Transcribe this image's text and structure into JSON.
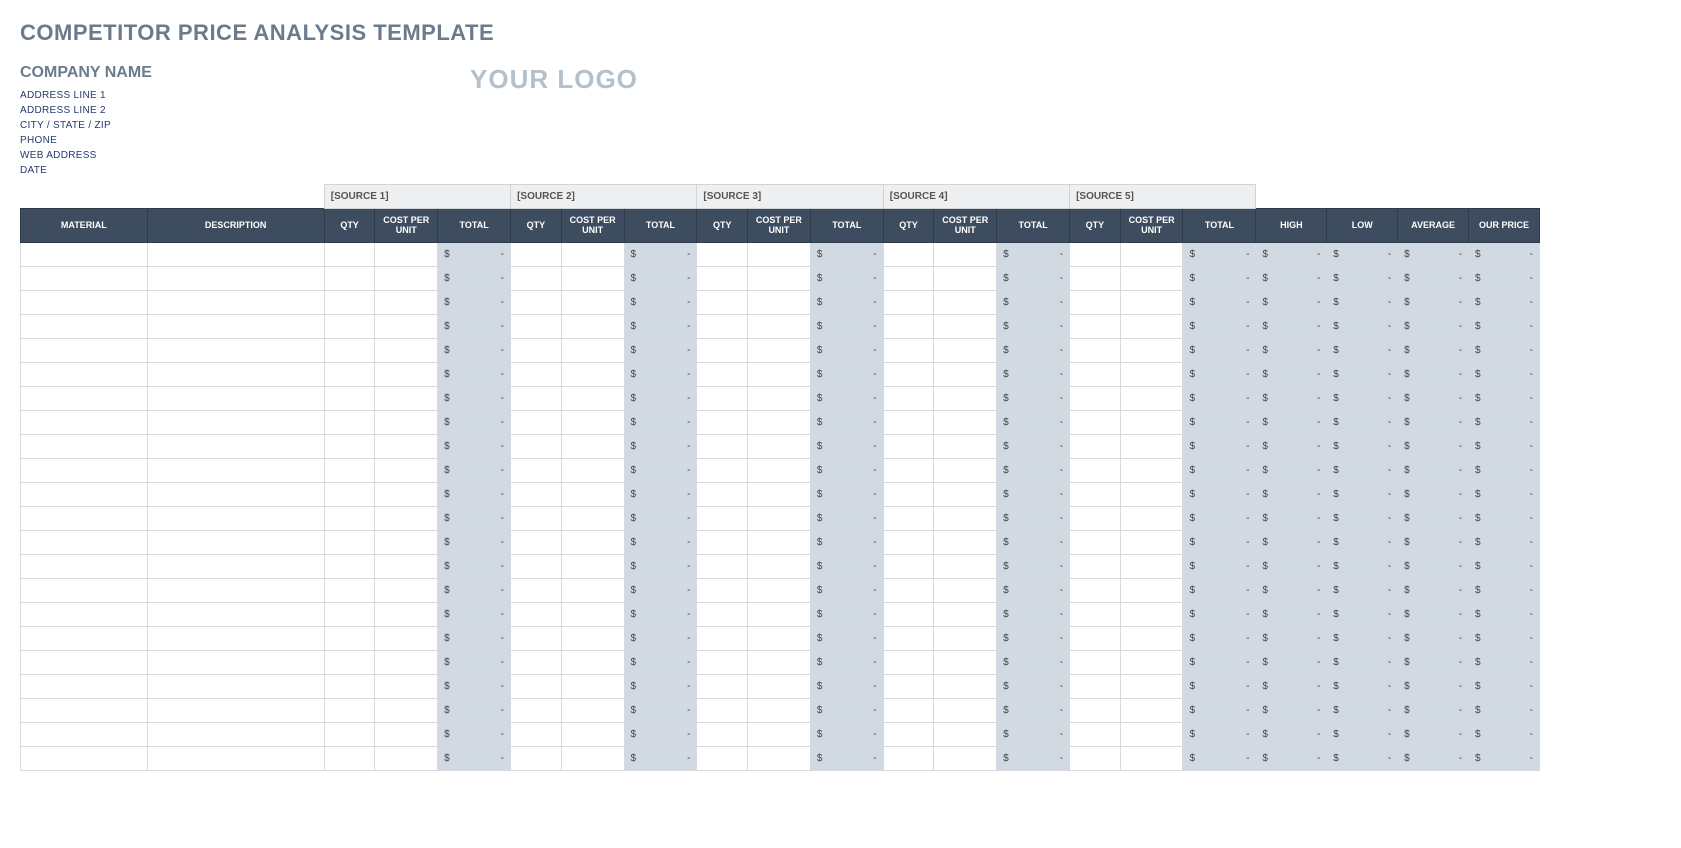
{
  "title": "COMPETITOR PRICE ANALYSIS TEMPLATE",
  "company": {
    "name_label": "COMPANY NAME",
    "address1": "ADDRESS LINE 1",
    "address2": "ADDRESS LINE 2",
    "csz": "CITY / STATE / ZIP",
    "phone": "PHONE",
    "web": "WEB ADDRESS",
    "date": "DATE"
  },
  "logo_text": "YOUR LOGO",
  "sources": [
    "[SOURCE 1]",
    "[SOURCE 2]",
    "[SOURCE 3]",
    "[SOURCE 4]",
    "[SOURCE 5]"
  ],
  "columns": {
    "material": "MATERIAL",
    "description": "DESCRIPTION",
    "qty": "QTY",
    "cpu": "COST PER UNIT",
    "total": "TOTAL",
    "high": "HIGH",
    "low": "LOW",
    "average": "AVERAGE",
    "our_price": "OUR PRICE"
  },
  "money_placeholder": {
    "currency": "$",
    "value": "-"
  },
  "row_count": 22
}
